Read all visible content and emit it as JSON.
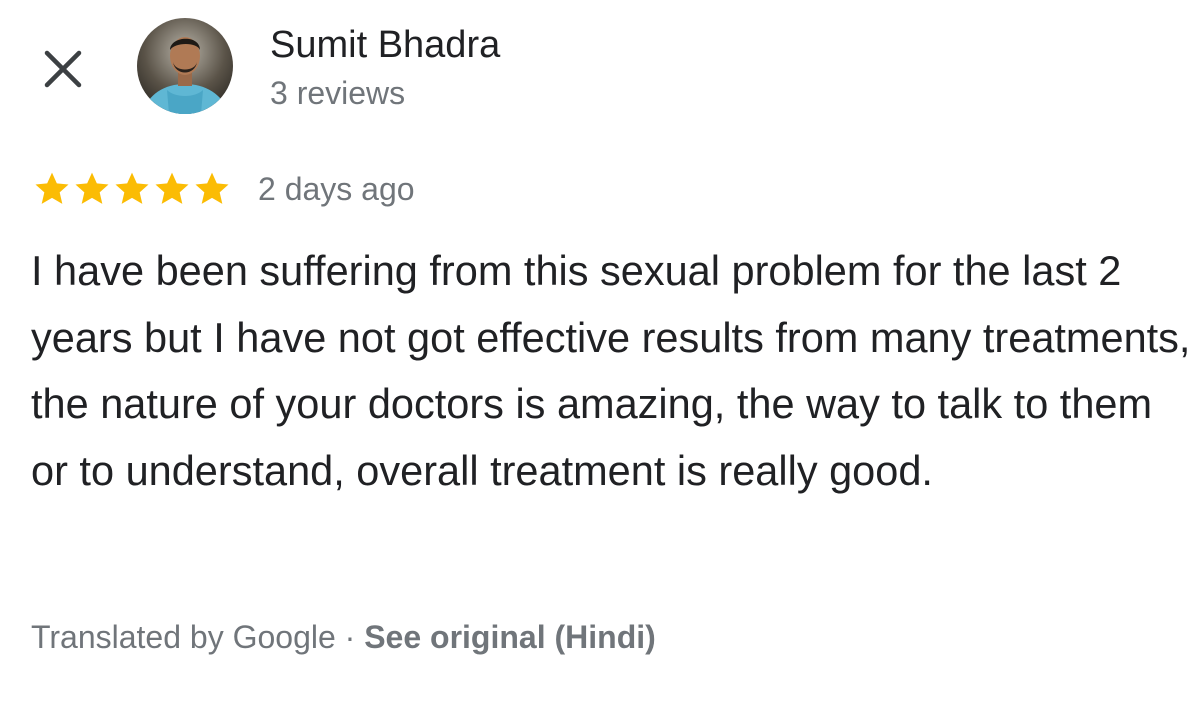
{
  "header": {
    "close_icon": "close-icon",
    "reviewer_name": "Sumit Bhadra",
    "review_count": "3 reviews"
  },
  "review": {
    "rating": 5,
    "max_rating": 5,
    "star_color": "#fbbc04",
    "date": "2 days ago",
    "text": "I have been suffering from this sexual problem for the last 2 years but I have not got effective results from many treatments, the nature of your doctors is amazing, the way to talk to them or to understand, overall treatment is really good."
  },
  "translation": {
    "translated_by": "Translated by Google",
    "separator": "·",
    "see_original": "See original (Hindi)"
  }
}
